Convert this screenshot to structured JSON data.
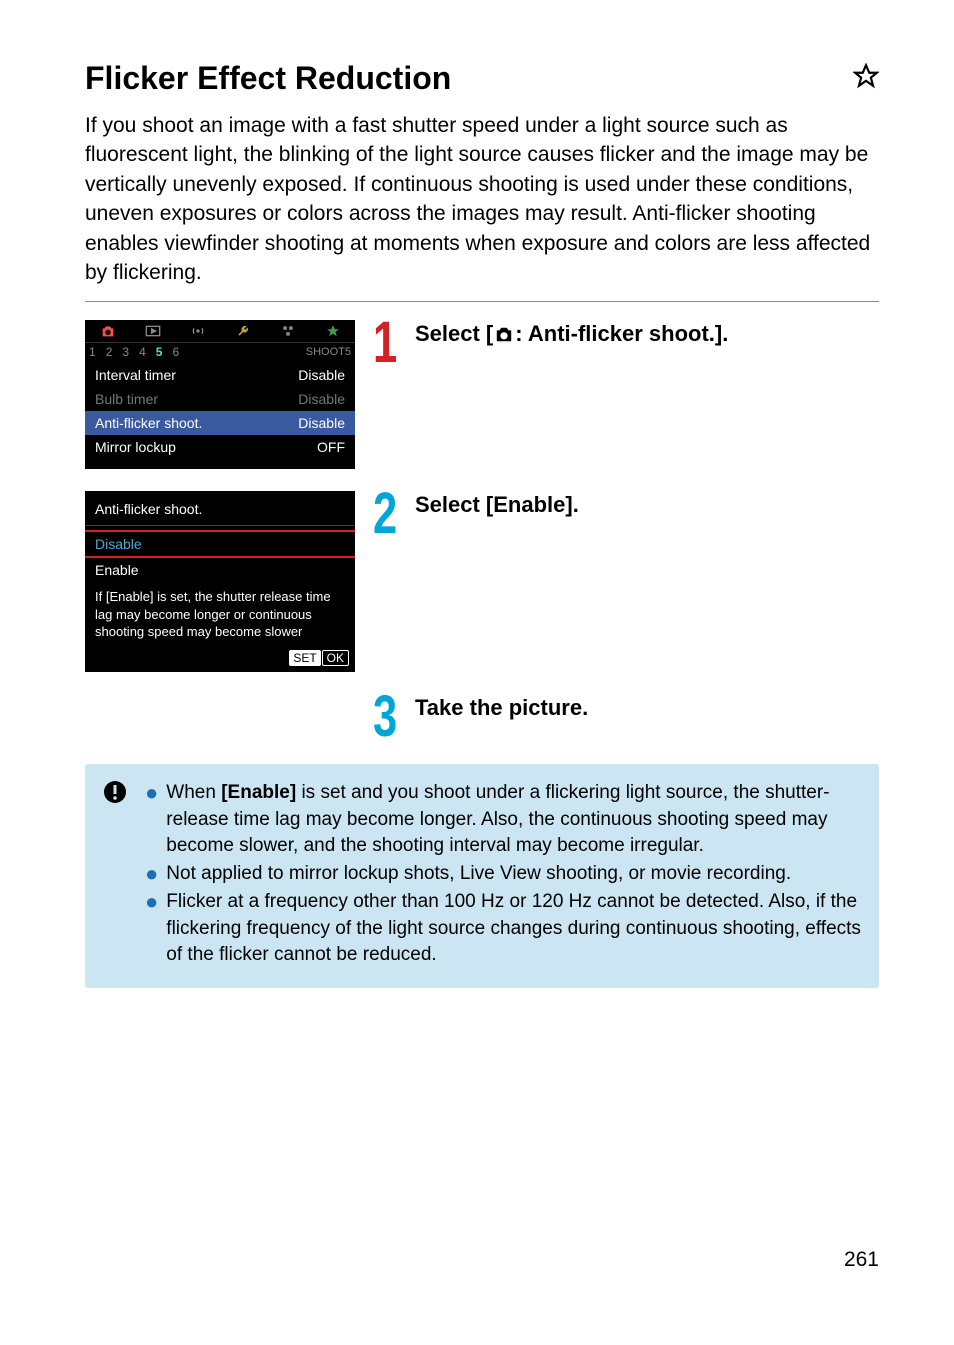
{
  "title": "Flicker Effect Reduction",
  "intro": "If you shoot an image with a fast shutter speed under a light source such as fluorescent light, the blinking of the light source causes flicker and the image may be vertically unevenly exposed. If continuous shooting is used under these conditions, uneven exposures or colors across the images may result. Anti-flicker shooting enables viewfinder shooting at moments when exposure and colors are less affected by flickering.",
  "screenshot1": {
    "tab_label": "SHOOT5",
    "subtabs": [
      "1",
      "2",
      "3",
      "4",
      "5",
      "6"
    ],
    "active_subtab": "5",
    "rows": [
      {
        "label": "Interval timer",
        "value": "Disable",
        "dim": false
      },
      {
        "label": "Bulb timer",
        "value": "Disable",
        "dim": true
      },
      {
        "label": "Anti-flicker shoot.",
        "value": "Disable",
        "dim": false,
        "selected": true
      },
      {
        "label": "Mirror lockup",
        "value": "OFF",
        "dim": false
      }
    ]
  },
  "screenshot2": {
    "header": "Anti-flicker shoot.",
    "options": [
      {
        "label": "Disable",
        "highlighted": true
      },
      {
        "label": "Enable",
        "highlighted": false
      }
    ],
    "hint": "If [Enable] is set, the shutter release time lag may become longer or continuous shooting speed may become slower",
    "button_set": "SET",
    "button_ok": "OK"
  },
  "steps": {
    "s1_pre": "Select [",
    "s1_post": ": Anti-flicker shoot.].",
    "s2": "Select [Enable].",
    "s3": "Take the picture."
  },
  "notes": {
    "b1_pre": "When ",
    "b1_bold": "[Enable]",
    "b1_post": " is set and you shoot under a flickering light source, the shutter-release time lag may become longer. Also, the continuous shooting speed may become slower, and the shooting interval may become irregular.",
    "b2": "Not applied to mirror lockup shots, Live View shooting, or movie recording.",
    "b3": "Flicker at a frequency other than 100 Hz or 120 Hz cannot be detected. Also, if the flickering frequency of the light source changes during continuous shooting, effects of the flicker cannot be reduced."
  },
  "page_number": "261"
}
